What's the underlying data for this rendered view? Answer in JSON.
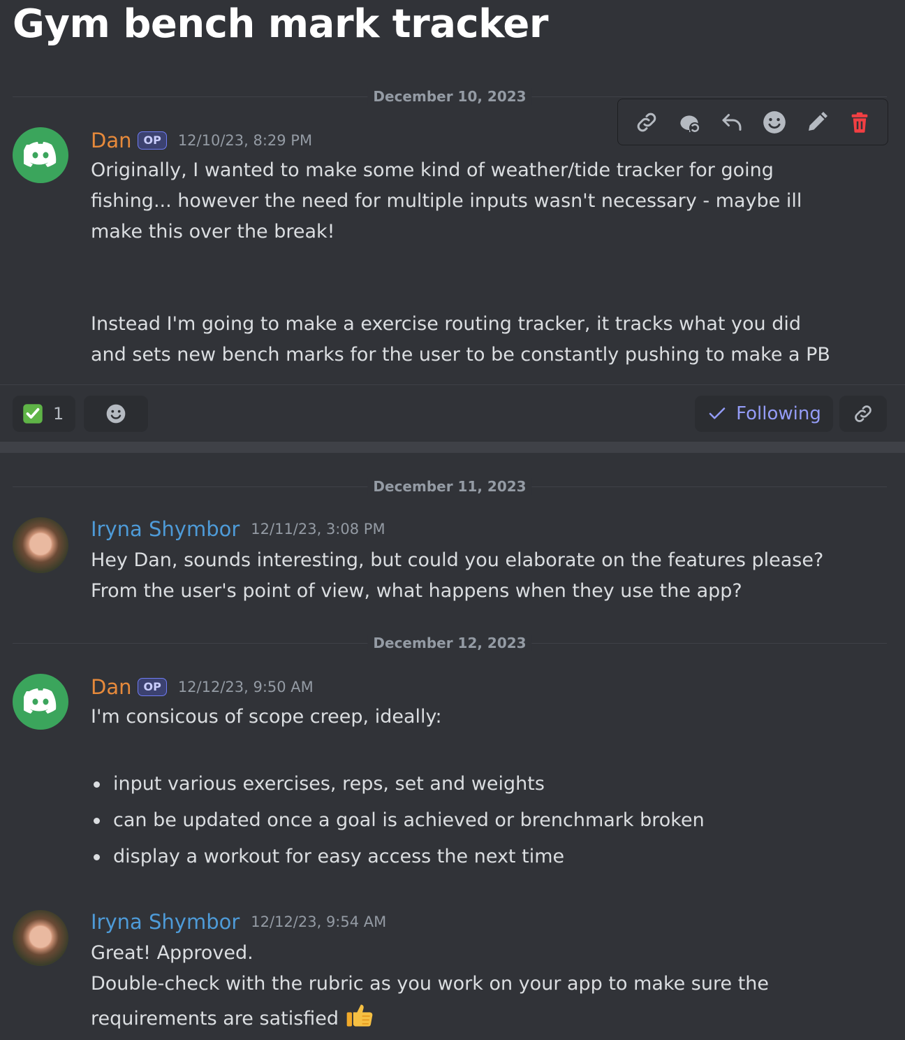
{
  "thread": {
    "title": "Gym bench mark tracker"
  },
  "dates": {
    "d1": "December 10, 2023",
    "d2": "December 11, 2023",
    "d3": "December 12, 2023"
  },
  "messages": [
    {
      "author": "Dan",
      "badge": "OP",
      "timestamp": "12/10/23, 8:29 PM",
      "paragraphs": [
        "Originally, I wanted to make some kind of weather/tide tracker for going fishing... however the need for multiple inputs wasn't necessary - maybe ill make this over the break!",
        "Instead I'm going to make a exercise routing tracker, it tracks what you did and sets new bench marks for the user to be constantly pushing to make a PB"
      ]
    },
    {
      "author": "Iryna Shymbor",
      "timestamp": "12/11/23, 3:08 PM",
      "paragraphs": [
        "Hey Dan, sounds interesting, but could you elaborate on the features please?",
        "From the user's point of view, what happens when they use the app?"
      ]
    },
    {
      "author": "Dan",
      "badge": "OP",
      "timestamp": "12/12/23, 9:50 AM",
      "intro": "I'm consicous  of scope creep, ideally:",
      "bullets": [
        "input various exercises, reps, set and weights",
        "can be updated once a goal is achieved or brenchmark broken",
        "display a workout for easy access the next time"
      ]
    },
    {
      "author": "Iryna Shymbor",
      "timestamp": "12/12/23, 9:54 AM",
      "paragraphs": [
        "Great! Approved.",
        "Double-check with the rubric as you work on your app to make sure the",
        "requirements are satisfied"
      ]
    }
  ],
  "reactions": {
    "check_count": "1"
  },
  "follow": {
    "label": "Following"
  },
  "colors": {
    "dan": "#e78a3b",
    "iryna": "#4e9bd8",
    "accent": "#949cf7",
    "delete": "#f23f43"
  },
  "icons": [
    "link-icon",
    "thread-reply-icon",
    "reply-icon",
    "emoji-icon",
    "edit-icon",
    "delete-icon",
    "check-icon",
    "thumbs-up-emoji"
  ]
}
